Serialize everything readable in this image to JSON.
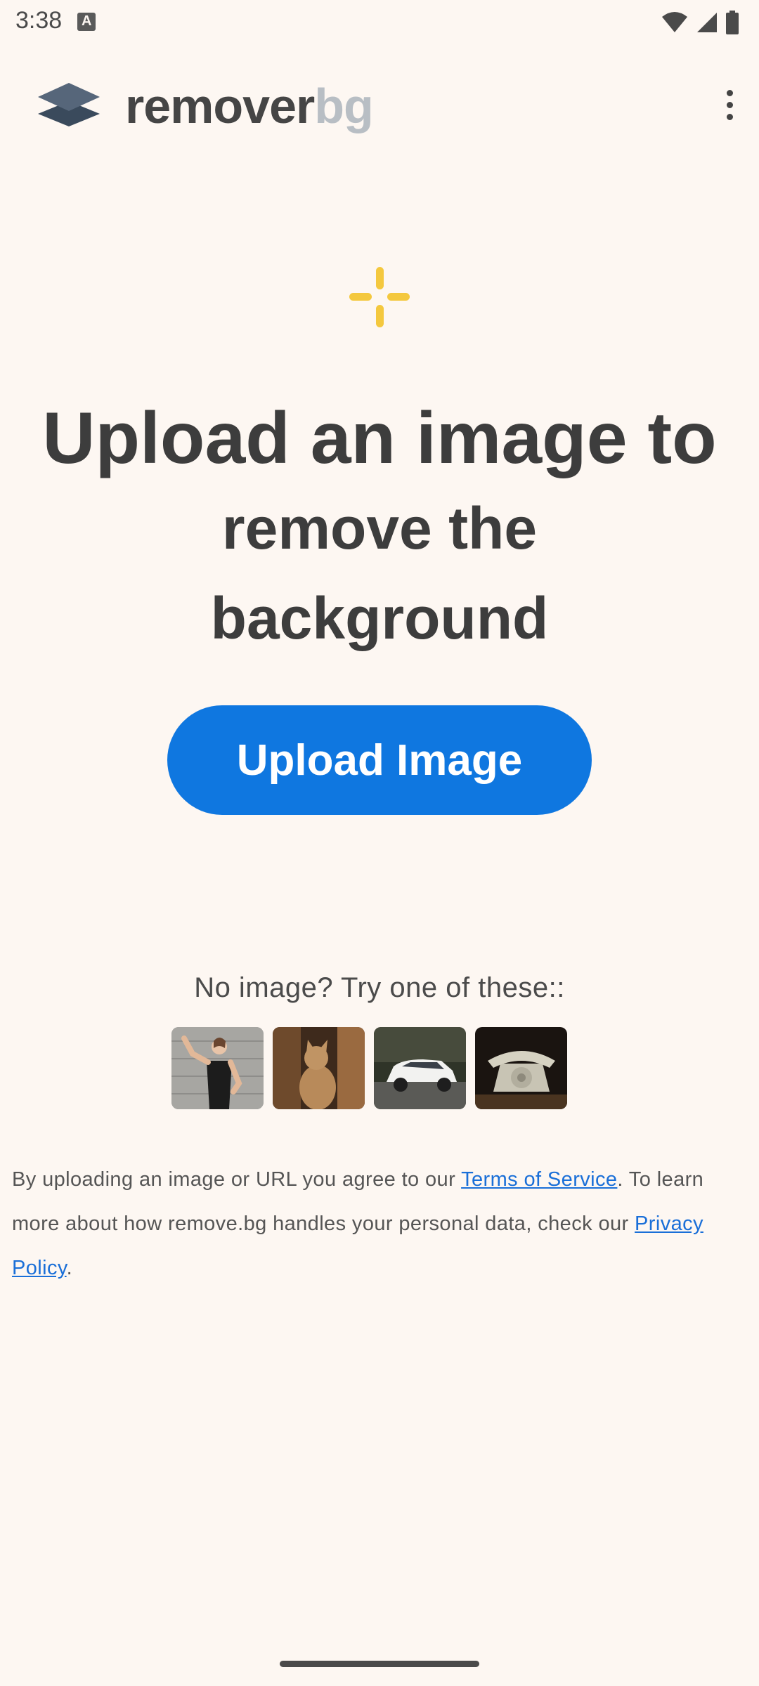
{
  "status_bar": {
    "time": "3:38"
  },
  "app_bar": {
    "logo_word_1": "remover",
    "logo_word_2": "bg",
    "logo_icon": "layers-logo-icon",
    "menu_icon": "more-vert-icon"
  },
  "hero": {
    "sparkle_icon": "sparkle-icon",
    "sparkle_color": "#f4c83e",
    "headline_line_1": "Upload an image to",
    "headline_line_2": "remove the",
    "headline_line_3": "background"
  },
  "upload": {
    "label": "Upload Image",
    "color": "#0f77e0"
  },
  "samples": {
    "label": "No image? Try one of these::",
    "items": [
      {
        "name": "woman",
        "icon": "sample-woman-image"
      },
      {
        "name": "cat",
        "icon": "sample-cat-image"
      },
      {
        "name": "car",
        "icon": "sample-car-image"
      },
      {
        "name": "telephone",
        "icon": "sample-telephone-image"
      }
    ]
  },
  "legal": {
    "text_1": "By uploading an image or URL you agree to our ",
    "terms_link": "Terms of Service",
    "text_2": ". To learn more about how remove.bg handles your personal data, check our ",
    "privacy_link": "Privacy Policy",
    "text_3": "."
  }
}
